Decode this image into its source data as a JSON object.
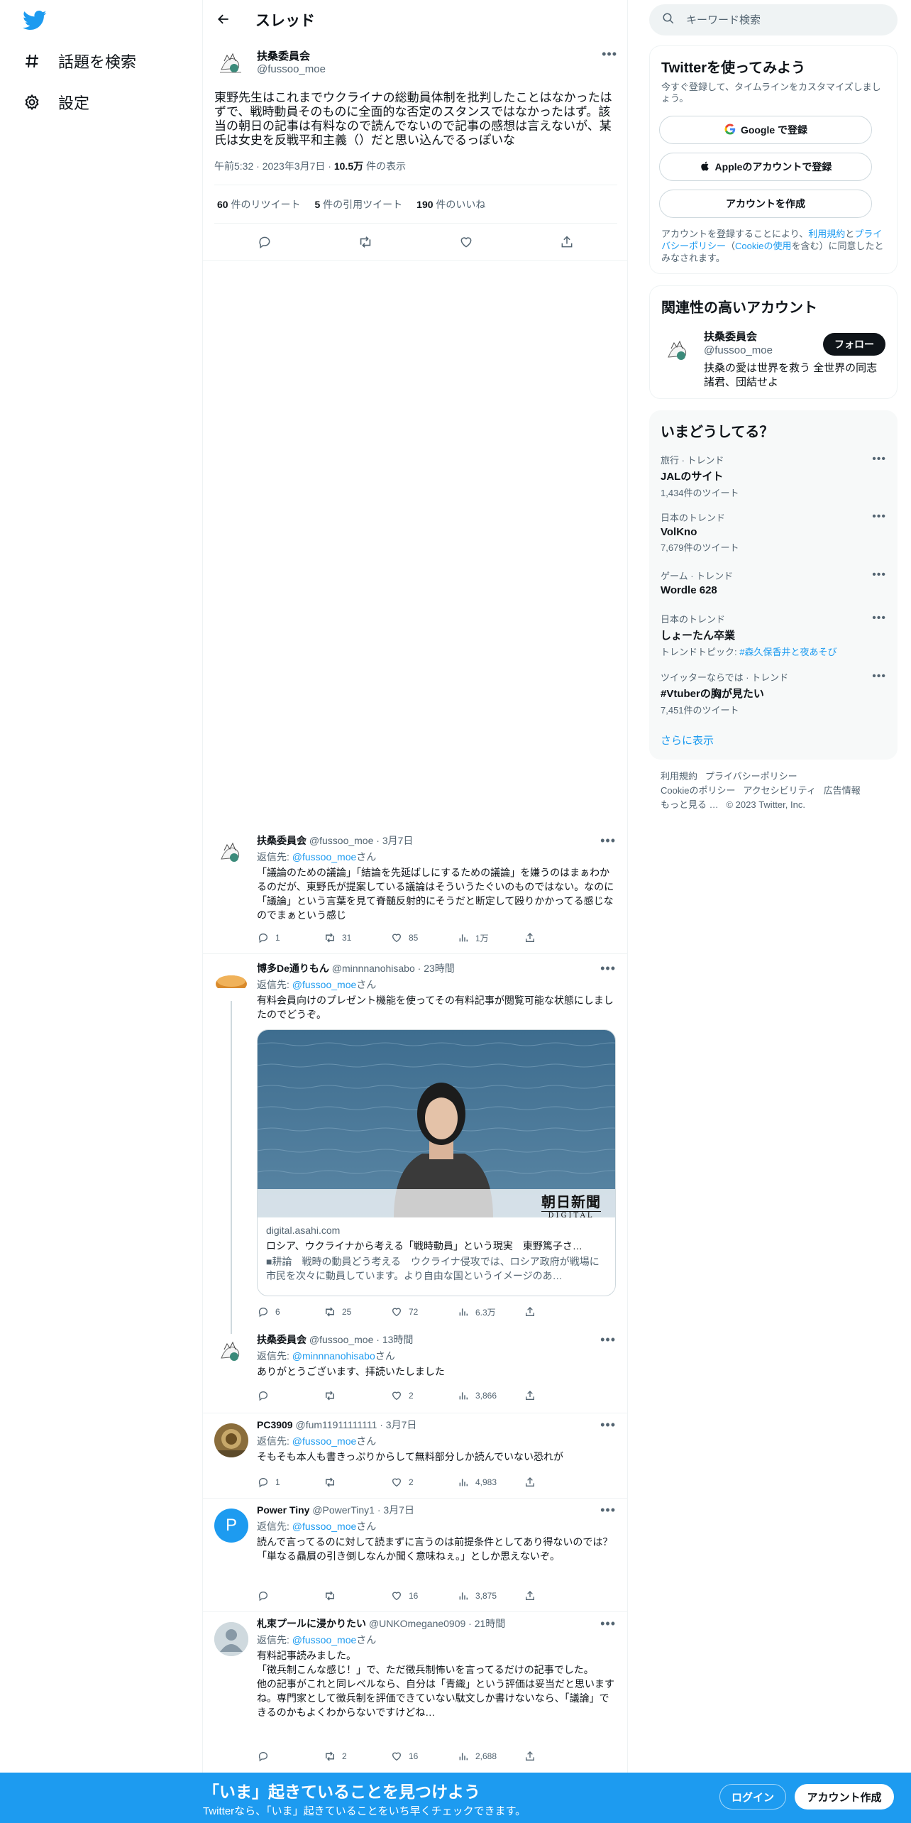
{
  "brand_color": "#1d9bf0",
  "leftnav": {
    "logo_icon": "twitter-bird-icon",
    "items": [
      {
        "label": "話題を検索",
        "icon": "hashtag-icon"
      },
      {
        "label": "設定",
        "icon": "gear-icon"
      }
    ]
  },
  "header": {
    "title": "スレッド",
    "back_icon": "arrow-left-icon"
  },
  "main_tweet": {
    "name": "扶桑委員会",
    "handle": "@fussoo_moe",
    "text": "東野先生はこれまでウクライナの総動員体制を批判したことはなかったはずで、戦時動員そのものに全面的な否定のスタンスではなかったはず。該当の朝日の記事は有料なので読んでないので記事の感想は言えないが、某氏は女史を反戦平和主義（）だと思い込んでるっぽいな",
    "time": "午前5:32 · 2023年3月7日 · ",
    "views": "10.5万",
    "views_label": " 件の表示",
    "retweets": "60",
    "retweets_label": " 件のリツイート",
    "quotes": "5",
    "quotes_label": " 件の引用ツイート",
    "likes": "190",
    "likes_label": " 件のいいね"
  },
  "replies": [
    {
      "name": "扶桑委員会",
      "handle": "@fussoo_moe · 3月7日",
      "replying_prefix": "返信先: ",
      "replying_to": "@fussoo_moe",
      "replying_suffix": "さん",
      "text": "「議論のための議論」「結論を先延ばしにするための議論」を嫌うのはまぁわかるのだが、東野氏が提案している議論はそういうたぐいのものではない。なのに「議論」という言葉を見て脊髄反射的にそうだと断定して殴りかかってる感じなのでまぁという感じ",
      "replies": "1",
      "retweets": "31",
      "likes": "85",
      "views": "1万"
    },
    {
      "name": "博多De通りもん",
      "handle": "@minnnanohisabo · 23時間",
      "replying_prefix": "返信先: ",
      "replying_to": "@fussoo_moe",
      "replying_suffix": "さん",
      "text": "有料会員向けのプレゼント機能を使ってその有料記事が閲覧可能な状態にしましたのでどうぞ。",
      "card": {
        "brand_text": "朝日新聞",
        "brand_sub": "DIGITAL",
        "domain": "digital.asahi.com",
        "title": "ロシア、ウクライナから考える「戦時動員」という現実　東野篤子さ…",
        "desc": "■耕論　戦時の動員どう考える　ウクライナ侵攻では、ロシア政府が戦場に市民を次々に動員しています。より自由な国というイメージのあ…"
      },
      "replies": "6",
      "retweets": "25",
      "likes": "72",
      "views": "6.3万"
    },
    {
      "name": "扶桑委員会",
      "handle": "@fussoo_moe · 13時間",
      "replying_prefix": "返信先: ",
      "replying_to": "@minnnanohisabo",
      "replying_suffix": "さん",
      "text": "ありがとうございます、拝読いたしました",
      "replies": "",
      "retweets": "",
      "likes": "2",
      "views": "3,866"
    },
    {
      "name": "PC3909",
      "handle": "@fum11911111111 · 3月7日",
      "replying_prefix": "返信先: ",
      "replying_to": "@fussoo_moe",
      "replying_suffix": "さん",
      "text": "そもそも本人も書きっぷりからして無料部分しか読んでいない恐れが",
      "replies": "1",
      "retweets": "",
      "likes": "2",
      "views": "4,983"
    },
    {
      "name": "Power Tiny",
      "handle": "@PowerTiny1 · 3月7日",
      "avatar_letter": "P",
      "replying_prefix": "返信先: ",
      "replying_to": "@fussoo_moe",
      "replying_suffix": "さん",
      "text": "読んで言ってるのに対して読まずに言うのは前提条件としてあり得ないのでは？\n「単なる贔屓の引き倒しなんか聞く意味ねぇ。」としか思えないぞ。",
      "replies": "",
      "retweets": "",
      "likes": "16",
      "views": "3,875"
    },
    {
      "name": "札束プールに浸かりたい",
      "handle": "@UNKOmegane0909 · 21時間",
      "replying_prefix": "返信先: ",
      "replying_to": "@fussoo_moe",
      "replying_suffix": "さん",
      "text": "有料記事読みました。\n「徴兵制こんな感じ！」で、ただ徴兵制怖いを言ってるだけの記事でした。\n他の記事がこれと同レベルなら、自分は「青織」という評価は妥当だと思いますね。専門家として徴兵制を評価できていない駄文しか書けないなら、「議論」できるのかもよくわからないですけどね…",
      "replies": "",
      "retweets": "2",
      "likes": "16",
      "views": "2,688"
    }
  ],
  "right": {
    "search_placeholder": "キーワード検索",
    "signup": {
      "title": "Twitterを使ってみよう",
      "subtitle": "今すぐ登録して、タイムラインをカスタマイズしましょう。",
      "google": "Google で登録",
      "apple": "Appleのアカウントで登録",
      "create": "アカウントを作成",
      "legal_1": "アカウントを登録することにより、",
      "legal_terms": "利用規約",
      "legal_2": "と",
      "legal_privacy": "プライバシーポリシー",
      "legal_3": "（",
      "legal_cookie": "Cookieの使用",
      "legal_4": "を含む）に同意したとみなされます。"
    },
    "related": {
      "title": "関連性の高いアカウント",
      "name": "扶桑委員会",
      "handle": "@fussoo_moe",
      "follow": "フォロー",
      "bio": "扶桑の愛は世界を救う 全世界の同志諸君、団結せよ"
    },
    "trends": {
      "title": "いまどうしてる？",
      "items": [
        {
          "context": "旅行 · トレンド",
          "name": "JALのサイト",
          "tweets": "1,434件のツイート"
        },
        {
          "context": "日本のトレンド",
          "name": "VolKno",
          "tweets": "7,679件のツイート"
        },
        {
          "context": "ゲーム · トレンド",
          "name": "Wordle 628",
          "tweets": ""
        },
        {
          "context": "日本のトレンド",
          "name": "しょーたん卒業",
          "tweets_prefix": "トレンドトピック: ",
          "tweets_link": "#森久保香井と夜あそび"
        },
        {
          "context": "ツイッターならでは · トレンド",
          "name": "#Vtuberの胸が見たい",
          "tweets": "7,451件のツイート"
        }
      ],
      "show_more": "さらに表示"
    },
    "footer": {
      "links_row1": [
        "利用規約",
        "プライバシーポリシー"
      ],
      "links_row2": [
        "Cookieのポリシー",
        "アクセシビリティ",
        "広告情報"
      ],
      "more": "もっと見る …",
      "copyright": "© 2023 Twitter, Inc."
    }
  },
  "bottombar": {
    "title": "「いま」起きていることを見つけよう",
    "subtitle": "Twitterなら、「いま」起きていることをいち早くチェックできます。",
    "login": "ログイン",
    "signup": "アカウント作成"
  }
}
